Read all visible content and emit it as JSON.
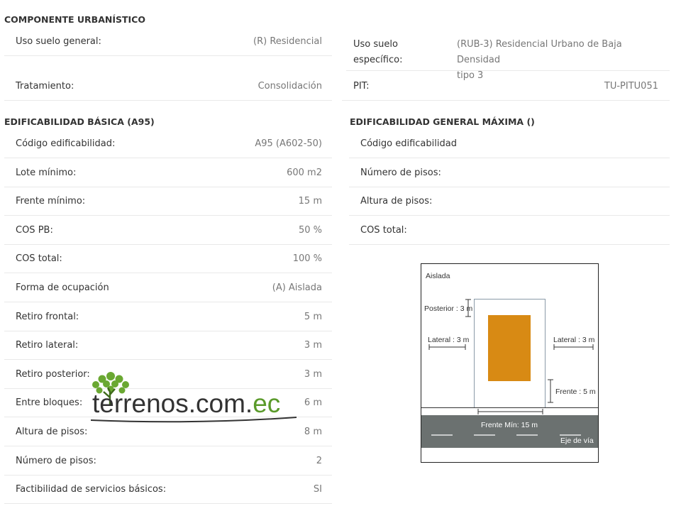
{
  "componente": {
    "title": "COMPONENTE URBANÍSTICO",
    "uso_general_label": "Uso suelo general:",
    "uso_general_value": "(R) Residencial",
    "uso_especifico_label_1": "Uso suelo",
    "uso_especifico_label_2": "específico:",
    "uso_especifico_value_1": "(RUB-3) Residencial Urbano de Baja Densidad",
    "uso_especifico_value_2": "tipo 3",
    "tratamiento_label": "Tratamiento:",
    "tratamiento_value": "Consolidación",
    "pit_label": "PIT:",
    "pit_value": "TU-PITU051"
  },
  "basica": {
    "title": "EDIFICABILIDAD BÁSICA (A95)",
    "rows": [
      {
        "label": "Código edificabilidad:",
        "value": "A95 (A602-50)"
      },
      {
        "label": "Lote mínimo:",
        "value": "600 m2"
      },
      {
        "label": "Frente mínimo:",
        "value": "15 m"
      },
      {
        "label": "COS PB:",
        "value": "50 %"
      },
      {
        "label": "COS total:",
        "value": "100 %"
      },
      {
        "label": "Forma de ocupación",
        "value": "(A) Aislada"
      },
      {
        "label": "Retiro frontal:",
        "value": "5 m"
      },
      {
        "label": "Retiro lateral:",
        "value": "3 m"
      },
      {
        "label": "Retiro posterior:",
        "value": "3 m"
      },
      {
        "label": "Entre bloques:",
        "value": "6 m"
      },
      {
        "label": "Altura de pisos:",
        "value": "8 m"
      },
      {
        "label": "Número de pisos:",
        "value": "2"
      },
      {
        "label": "Factibilidad de servicios básicos:",
        "value": "SI"
      }
    ]
  },
  "maxima": {
    "title": "EDIFICABILIDAD GENERAL MÁXIMA ()",
    "rows": [
      {
        "label": "Código edificabilidad",
        "value": ""
      },
      {
        "label": "Número de pisos:",
        "value": ""
      },
      {
        "label": "Altura de pisos:",
        "value": ""
      },
      {
        "label": "COS total:",
        "value": ""
      }
    ]
  },
  "diagram": {
    "aislada": "Aislada",
    "posterior": "Posterior : 3 m",
    "lateral_left": "Lateral : 3 m",
    "lateral_right": "Lateral : 3 m",
    "frente": "Frente : 5 m",
    "frente_min": "Frente Mín: 15 m",
    "eje": "Eje de vía",
    "building_color": "#d88a14",
    "road_color": "#6b7170"
  },
  "logo": {
    "text_main": "terrenos.com.",
    "text_ec": "ec",
    "brand_color": "#5a9a2a"
  }
}
